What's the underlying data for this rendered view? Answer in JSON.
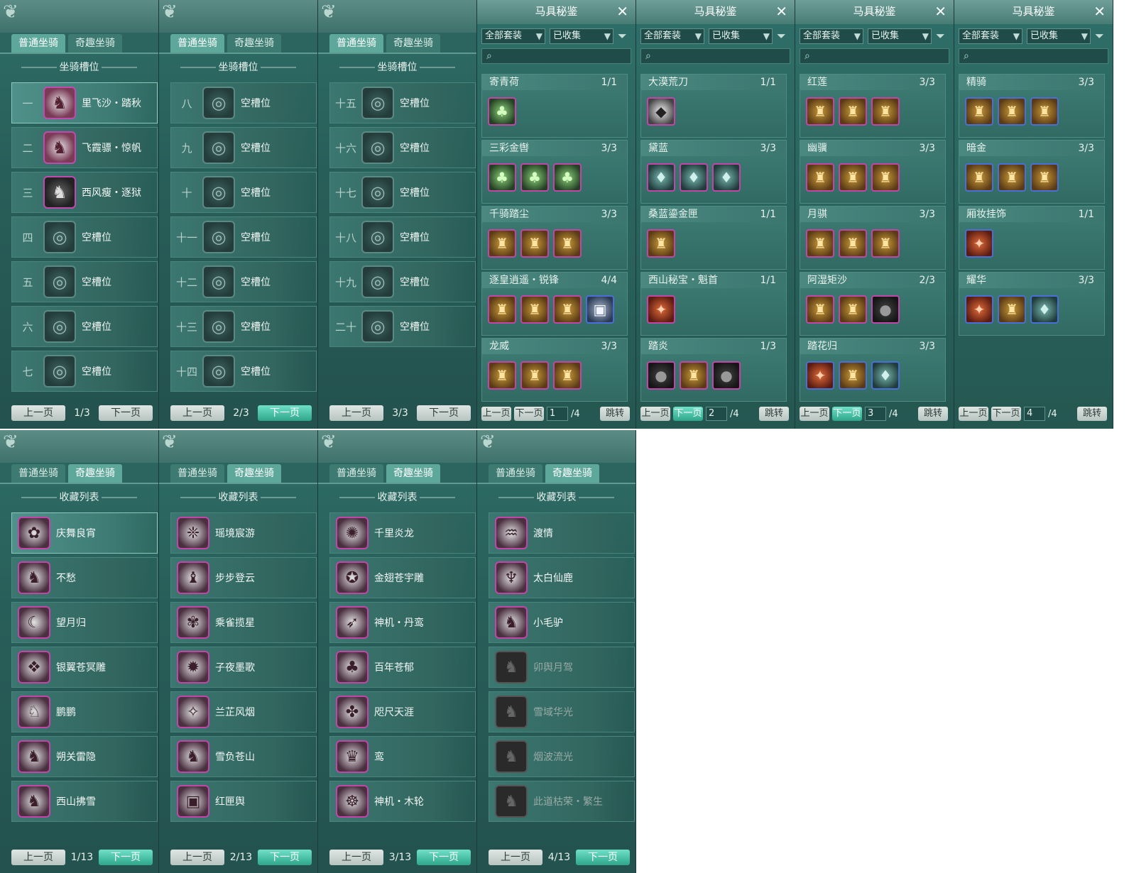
{
  "mount_tabs": [
    "普通坐骑",
    "奇趣坐骑"
  ],
  "slots_title": "坐骑槽位",
  "collection_title": "收藏列表",
  "prev": "上一页",
  "next": "下一页",
  "slot_pages": [
    {
      "page": "1/3",
      "slots": [
        {
          "num": "一",
          "name": "里飞沙・踏秋",
          "filled": true
        },
        {
          "num": "二",
          "name": "飞霞骠・惊帆",
          "filled": true
        },
        {
          "num": "三",
          "name": "西风瘦・逐狱",
          "filled": true
        },
        {
          "num": "四",
          "name": "空槽位",
          "filled": false
        },
        {
          "num": "五",
          "name": "空槽位",
          "filled": false
        },
        {
          "num": "六",
          "name": "空槽位",
          "filled": false
        },
        {
          "num": "七",
          "name": "空槽位",
          "filled": false
        }
      ]
    },
    {
      "page": "2/3",
      "slots": [
        {
          "num": "八",
          "name": "空槽位",
          "filled": false
        },
        {
          "num": "九",
          "name": "空槽位",
          "filled": false
        },
        {
          "num": "十",
          "name": "空槽位",
          "filled": false
        },
        {
          "num": "十一",
          "name": "空槽位",
          "filled": false
        },
        {
          "num": "十二",
          "name": "空槽位",
          "filled": false
        },
        {
          "num": "十三",
          "name": "空槽位",
          "filled": false
        },
        {
          "num": "十四",
          "name": "空槽位",
          "filled": false
        }
      ]
    },
    {
      "page": "3/3",
      "slots": [
        {
          "num": "十五",
          "name": "空槽位",
          "filled": false
        },
        {
          "num": "十六",
          "name": "空槽位",
          "filled": false
        },
        {
          "num": "十七",
          "name": "空槽位",
          "filled": false
        },
        {
          "num": "十八",
          "name": "空槽位",
          "filled": false
        },
        {
          "num": "十九",
          "name": "空槽位",
          "filled": false
        },
        {
          "num": "二十",
          "name": "空槽位",
          "filled": false
        },
        {
          "num": "",
          "name": "",
          "filled": false
        }
      ]
    }
  ],
  "collection_window": {
    "title": "马具秘鉴",
    "filter_set": "全部套装",
    "filter_state": "已收集",
    "jump": "跳转",
    "total": "/4"
  },
  "collection_pages": [
    {
      "page": "1",
      "sets": [
        {
          "name": "寄青荷",
          "count": "1/1",
          "items": [
            "green"
          ]
        },
        {
          "name": "三彩金辔",
          "count": "3/3",
          "items": [
            "green",
            "green",
            "green"
          ]
        },
        {
          "name": "千骑踏尘",
          "count": "3/3",
          "items": [
            "gold",
            "gold",
            "gold"
          ]
        },
        {
          "name": "逐皇逍遥・锐锋",
          "count": "4/4",
          "items": [
            "gold",
            "gold",
            "gold",
            "sea"
          ]
        },
        {
          "name": "龙威",
          "count": "3/3",
          "items": [
            "gold",
            "gold",
            "gold"
          ]
        }
      ]
    },
    {
      "page": "2",
      "sets": [
        {
          "name": "大漠荒刀",
          "count": "1/1",
          "items": [
            "white"
          ]
        },
        {
          "name": "黛蓝",
          "count": "3/3",
          "items": [
            "teal",
            "teal",
            "teal"
          ]
        },
        {
          "name": "桑蓝鎏金匣",
          "count": "1/1",
          "items": [
            "gold"
          ]
        },
        {
          "name": "西山秘宝・魁首",
          "count": "1/1",
          "items": [
            "red"
          ]
        },
        {
          "name": "踏炎",
          "count": "1/3",
          "items": [
            "dark",
            "gold",
            "dark"
          ]
        }
      ]
    },
    {
      "page": "3",
      "sets": [
        {
          "name": "红莲",
          "count": "3/3",
          "items": [
            "gold",
            "gold",
            "gold"
          ]
        },
        {
          "name": "幽骥",
          "count": "3/3",
          "items": [
            "gold",
            "gold",
            "gold"
          ]
        },
        {
          "name": "月骐",
          "count": "3/3",
          "items": [
            "gold",
            "gold",
            "gold"
          ]
        },
        {
          "name": "阿湿矩沙",
          "count": "2/3",
          "items": [
            "gold",
            "gold",
            "dark"
          ]
        },
        {
          "name": "踏花归",
          "count": "3/3",
          "items": [
            "red",
            "gold",
            "teal"
          ]
        }
      ]
    },
    {
      "page": "4",
      "sets": [
        {
          "name": "精骑",
          "count": "3/3",
          "items": [
            "gold",
            "gold",
            "gold"
          ]
        },
        {
          "name": "暗金",
          "count": "3/3",
          "items": [
            "gold",
            "gold",
            "gold"
          ]
        },
        {
          "name": "厢妆挂饰",
          "count": "1/1",
          "items": [
            "red"
          ]
        },
        {
          "name": "耀华",
          "count": "3/3",
          "items": [
            "red",
            "gold",
            "teal"
          ]
        }
      ]
    }
  ],
  "fun_pages": [
    {
      "page": "1/13",
      "mounts": [
        {
          "name": "庆舞良宵",
          "owned": true
        },
        {
          "name": "不愁",
          "owned": true
        },
        {
          "name": "望月归",
          "owned": true
        },
        {
          "name": "银翼苍冥雕",
          "owned": true
        },
        {
          "name": "鹏鹏",
          "owned": true
        },
        {
          "name": "朔关雷隐",
          "owned": true
        },
        {
          "name": "西山拂雪",
          "owned": true
        }
      ]
    },
    {
      "page": "2/13",
      "mounts": [
        {
          "name": "瑶境宸游",
          "owned": true
        },
        {
          "name": "步步登云",
          "owned": true
        },
        {
          "name": "乘雀揽星",
          "owned": true
        },
        {
          "name": "子夜墨歌",
          "owned": true
        },
        {
          "name": "兰芷风烟",
          "owned": true
        },
        {
          "name": "雪负苍山",
          "owned": true
        },
        {
          "name": "红匣舆",
          "owned": true
        }
      ]
    },
    {
      "page": "3/13",
      "mounts": [
        {
          "name": "千里炎龙",
          "owned": true
        },
        {
          "name": "金翅苍宇雕",
          "owned": true
        },
        {
          "name": "神机・丹鸾",
          "owned": true
        },
        {
          "name": "百年苍郁",
          "owned": true
        },
        {
          "name": "咫尺天涯",
          "owned": true
        },
        {
          "name": "鸾",
          "owned": true
        },
        {
          "name": "神机・木轮",
          "owned": true
        }
      ]
    },
    {
      "page": "4/13",
      "mounts": [
        {
          "name": "渡情",
          "owned": true
        },
        {
          "name": "太白仙鹿",
          "owned": true
        },
        {
          "name": "小毛驴",
          "owned": true
        },
        {
          "name": "卯舆月驾",
          "owned": false
        },
        {
          "name": "雪域华光",
          "owned": false
        },
        {
          "name": "烟波流光",
          "owned": false
        },
        {
          "name": "此道枯荣・繁生",
          "owned": false
        }
      ]
    }
  ]
}
